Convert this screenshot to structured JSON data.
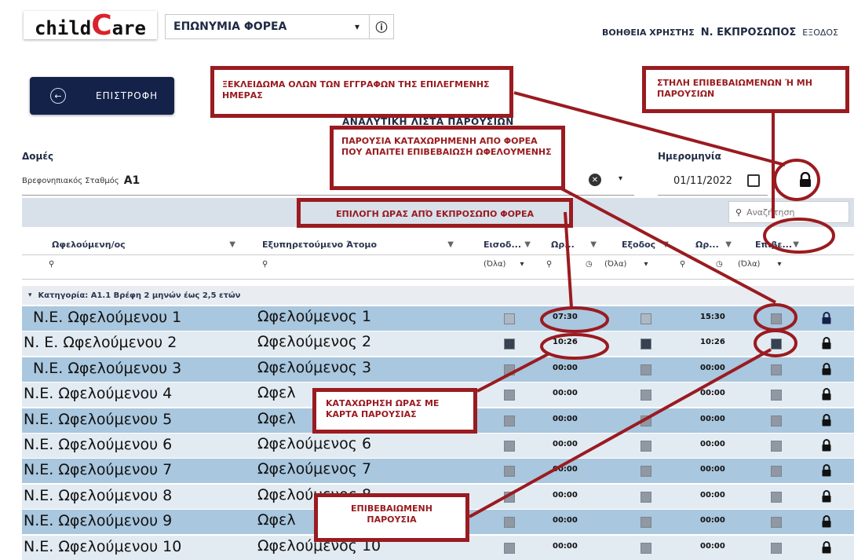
{
  "header": {
    "logo_prefix": "child",
    "logo_big": "C",
    "logo_suffix": "are",
    "entity_select": "ΕΠΩΝΥΜΙΑ ΦΟΡΕΑ",
    "help": "ΒΟΗΘΕΙΑ ΧΡΗΣΤΗΣ",
    "representative": "Ν. ΕΚΠΡΟΣΩΠΟΣ",
    "exit": "ΕΞΟΔΟΣ"
  },
  "toolbar": {
    "back_label": "ΕΠΙΣΤΡΟΦΗ",
    "subtitle": "ΑΝΑΛΥΤΙΚΗ ΛΙΣΤΑ ΠΑΡΟΥΣΙΩΝ"
  },
  "filters": {
    "structures_label": "Δομές",
    "station_type": "Βρεφονηπιακός Σταθμός",
    "station_name": "Α1",
    "date_label": "Ημερομηνία",
    "date_value": "01/11/2022",
    "search_placeholder": "Αναζήτηση"
  },
  "table": {
    "columns": [
      "Ωφελούμενη/ος",
      "Εξυπηρετούμενο Άτομο",
      "Εισοδ...",
      "Ωρ...",
      "Εξοδος",
      "Ωρ...",
      "Επιβε..."
    ],
    "filter_all": "(Όλα)",
    "group_label": "Κατηγορία: Α1.1 Βρέφη 2 μηνών έως 2,5 ετών",
    "rows": [
      {
        "name": "Ν.Ε. Ωφελούμενου 1",
        "person": "Ωφελούμενος 1",
        "in_time": "07:30",
        "out_time": "15:30"
      },
      {
        "name": "Ν. Ε. Ωφελούμενου 2",
        "person": "Ωφελούμενος 2",
        "in_time": "10:26",
        "out_time": "10:26"
      },
      {
        "name": "Ν.Ε. Ωφελούμενου 3",
        "person": "Ωφελούμενος 3",
        "in_time": "00:00",
        "out_time": "00:00"
      },
      {
        "name": "Ν.Ε. Ωφελούμενου 4",
        "person": "Ωφελ",
        "in_time": "00:00",
        "out_time": "00:00"
      },
      {
        "name": "Ν.Ε. Ωφελούμενου 5",
        "person": "Ωφελ",
        "in_time": "00:00",
        "out_time": "00:00"
      },
      {
        "name": "Ν.Ε. Ωφελούμενου 6",
        "person": "Ωφελούμενος 6",
        "in_time": "00:00",
        "out_time": "00:00"
      },
      {
        "name": "Ν.Ε. Ωφελούμενου 7",
        "person": "Ωφελούμενος 7",
        "in_time": "00:00",
        "out_time": "00:00"
      },
      {
        "name": "Ν.Ε. Ωφελούμενου 8",
        "person": "Ωφελούμενος 8",
        "in_time": "00:00",
        "out_time": "00:00"
      },
      {
        "name": "Ν.Ε. Ωφελούμενου 9",
        "person": "Ωφελ",
        "in_time": "00:00",
        "out_time": "00:00"
      },
      {
        "name": "Ν.Ε. Ωφελούμενου 10",
        "person": "Ωφελούμενος 10",
        "in_time": "00:00",
        "out_time": "00:00"
      }
    ]
  },
  "annotations": {
    "unlock_all": "ΞΕΚΛΕΙΔΩΜΑ ΟΛΩΝ ΤΩΝ ΕΓΓΡΑΦΩΝ ΤΗΣ ΕΠΙΛΕΓΜΕΝΗΣ ΗΜΕΡΑΣ",
    "confirm_column": "ΣΤΗΛΗ ΕΠΙΒΕΒΑΙΩΜΕΝΩΝ Ή ΜΗ ΠΑΡΟΥΣΙΩΝ",
    "needs_confirmation": "ΠΑΡΟΥΣΙΑ ΚΑΤΑΧΩΡΗΜΕΝΗ ΑΠΟ ΦΟΡΕΑ ΠΟΥ ΑΠΑΙΤΕΙ ΕΠΙΒΕΒΑΙΩΣΗ ΩΦΕΛΟΥΜΕΝΗΣ",
    "time_by_rep": "ΕΠΙΛΟΓΗ ΩΡΑΣ ΑΠΌ ΕΚΠΡΟΣΩΠΟ ΦΟΡΕΑ",
    "card_entry": "ΚΑΤΑΧΩΡΗΣΗ ΩΡΑΣ ΜΕ ΚΑΡΤΑ ΠΑΡΟΥΣΙΑΣ",
    "confirmed": "ΕΠΙΒΕΒΑΙΩΜΕΝΗ ΠΑΡΟΥΣΙΑ"
  },
  "colors": {
    "annotation": "#9a1b20",
    "back_button": "#14224a",
    "row_blue": "#a9c7de",
    "row_light": "#e3ebf2",
    "logo_accent": "#d8232a"
  }
}
